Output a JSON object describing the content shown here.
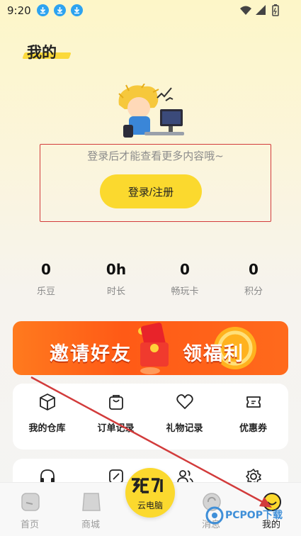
{
  "status_bar": {
    "time": "9:20"
  },
  "page": {
    "title": "我的"
  },
  "login": {
    "tip": "登录后才能查看更多内容哦~",
    "button_label": "登录/注册"
  },
  "stats": [
    {
      "value": "0",
      "label": "乐豆"
    },
    {
      "value": "0h",
      "label": "时长"
    },
    {
      "value": "0",
      "label": "畅玩卡"
    },
    {
      "value": "0",
      "label": "积分"
    }
  ],
  "banner": {
    "left_text": "邀请好友",
    "right_text": "领福利"
  },
  "menu": [
    {
      "label": "我的仓库",
      "icon": "box-icon"
    },
    {
      "label": "订单记录",
      "icon": "bag-icon"
    },
    {
      "label": "礼物记录",
      "icon": "heart-icon"
    },
    {
      "label": "优惠券",
      "icon": "ticket-icon"
    }
  ],
  "menu2_icons": [
    "headset-icon",
    "edit-icon",
    "users-icon",
    "settings-icon"
  ],
  "bottom_nav": [
    {
      "label": "首页",
      "icon": "home-icon"
    },
    {
      "label": "商城",
      "icon": "shop-icon"
    },
    {
      "label": "云电脑",
      "icon": "cloud-pc-icon"
    },
    {
      "label": "消息",
      "icon": "message-icon"
    },
    {
      "label": "我的",
      "icon": "profile-icon"
    }
  ],
  "watermark": {
    "text": "PCPOP下载"
  },
  "colors": {
    "accent": "#fbd92e",
    "banner": "#ff6a1c",
    "annotation": "#d23b3b"
  }
}
